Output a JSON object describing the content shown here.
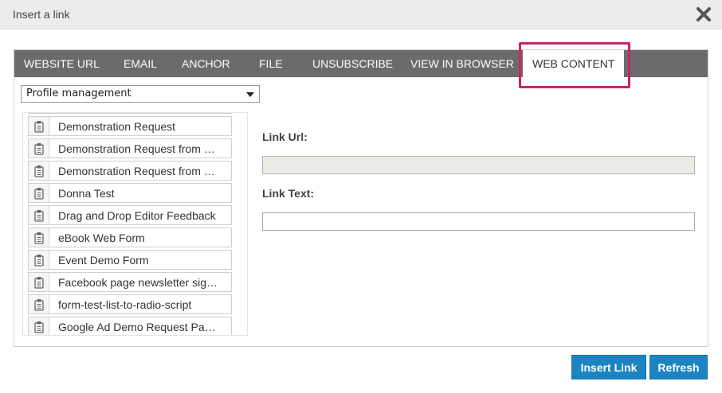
{
  "dialog": {
    "title": "Insert a link",
    "close_icon": "close-icon"
  },
  "tabs": [
    {
      "label": "WEBSITE URL"
    },
    {
      "label": "EMAIL"
    },
    {
      "label": "ANCHOR"
    },
    {
      "label": "FILE"
    },
    {
      "label": "UNSUBSCRIBE"
    },
    {
      "label": "VIEW IN BROWSER"
    },
    {
      "label": "WEB CONTENT",
      "active": true
    }
  ],
  "highlight_color": "#c8246b",
  "category_select": {
    "value": "Profile management"
  },
  "forms": {
    "icon": "clipboard-icon",
    "items": [
      "",
      "Demonstration Request",
      "Demonstration Request from …",
      "Demonstration Request from …",
      "Donna Test",
      "Drag and Drop Editor Feedback",
      "eBook Web Form",
      "Event Demo Form",
      "Facebook page newsletter sig…",
      "form-test-list-to-radio-script",
      "Google Ad Demo Request Pa…"
    ]
  },
  "link_form": {
    "url_label": "Link Url:",
    "url_value": "",
    "text_label": "Link Text:",
    "text_value": ""
  },
  "buttons": {
    "insert": "Insert Link",
    "refresh": "Refresh"
  },
  "colors": {
    "tabbar": "#6b6b6b",
    "button": "#1d84c3"
  }
}
